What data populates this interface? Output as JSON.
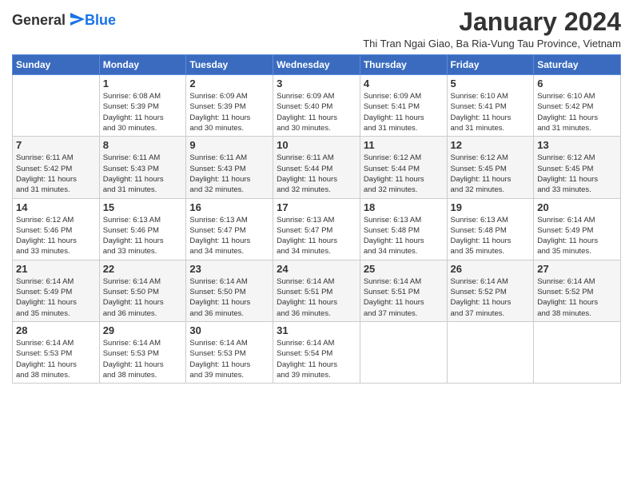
{
  "logo": {
    "general": "General",
    "blue": "Blue"
  },
  "title": "January 2024",
  "subtitle": "Thi Tran Ngai Giao, Ba Ria-Vung Tau Province, Vietnam",
  "days_of_week": [
    "Sunday",
    "Monday",
    "Tuesday",
    "Wednesday",
    "Thursday",
    "Friday",
    "Saturday"
  ],
  "weeks": [
    [
      {
        "day": "",
        "info": ""
      },
      {
        "day": "1",
        "info": "Sunrise: 6:08 AM\nSunset: 5:39 PM\nDaylight: 11 hours\nand 30 minutes."
      },
      {
        "day": "2",
        "info": "Sunrise: 6:09 AM\nSunset: 5:39 PM\nDaylight: 11 hours\nand 30 minutes."
      },
      {
        "day": "3",
        "info": "Sunrise: 6:09 AM\nSunset: 5:40 PM\nDaylight: 11 hours\nand 30 minutes."
      },
      {
        "day": "4",
        "info": "Sunrise: 6:09 AM\nSunset: 5:41 PM\nDaylight: 11 hours\nand 31 minutes."
      },
      {
        "day": "5",
        "info": "Sunrise: 6:10 AM\nSunset: 5:41 PM\nDaylight: 11 hours\nand 31 minutes."
      },
      {
        "day": "6",
        "info": "Sunrise: 6:10 AM\nSunset: 5:42 PM\nDaylight: 11 hours\nand 31 minutes."
      }
    ],
    [
      {
        "day": "7",
        "info": "Sunrise: 6:11 AM\nSunset: 5:42 PM\nDaylight: 11 hours\nand 31 minutes."
      },
      {
        "day": "8",
        "info": "Sunrise: 6:11 AM\nSunset: 5:43 PM\nDaylight: 11 hours\nand 31 minutes."
      },
      {
        "day": "9",
        "info": "Sunrise: 6:11 AM\nSunset: 5:43 PM\nDaylight: 11 hours\nand 32 minutes."
      },
      {
        "day": "10",
        "info": "Sunrise: 6:11 AM\nSunset: 5:44 PM\nDaylight: 11 hours\nand 32 minutes."
      },
      {
        "day": "11",
        "info": "Sunrise: 6:12 AM\nSunset: 5:44 PM\nDaylight: 11 hours\nand 32 minutes."
      },
      {
        "day": "12",
        "info": "Sunrise: 6:12 AM\nSunset: 5:45 PM\nDaylight: 11 hours\nand 32 minutes."
      },
      {
        "day": "13",
        "info": "Sunrise: 6:12 AM\nSunset: 5:45 PM\nDaylight: 11 hours\nand 33 minutes."
      }
    ],
    [
      {
        "day": "14",
        "info": "Sunrise: 6:12 AM\nSunset: 5:46 PM\nDaylight: 11 hours\nand 33 minutes."
      },
      {
        "day": "15",
        "info": "Sunrise: 6:13 AM\nSunset: 5:46 PM\nDaylight: 11 hours\nand 33 minutes."
      },
      {
        "day": "16",
        "info": "Sunrise: 6:13 AM\nSunset: 5:47 PM\nDaylight: 11 hours\nand 34 minutes."
      },
      {
        "day": "17",
        "info": "Sunrise: 6:13 AM\nSunset: 5:47 PM\nDaylight: 11 hours\nand 34 minutes."
      },
      {
        "day": "18",
        "info": "Sunrise: 6:13 AM\nSunset: 5:48 PM\nDaylight: 11 hours\nand 34 minutes."
      },
      {
        "day": "19",
        "info": "Sunrise: 6:13 AM\nSunset: 5:48 PM\nDaylight: 11 hours\nand 35 minutes."
      },
      {
        "day": "20",
        "info": "Sunrise: 6:14 AM\nSunset: 5:49 PM\nDaylight: 11 hours\nand 35 minutes."
      }
    ],
    [
      {
        "day": "21",
        "info": "Sunrise: 6:14 AM\nSunset: 5:49 PM\nDaylight: 11 hours\nand 35 minutes."
      },
      {
        "day": "22",
        "info": "Sunrise: 6:14 AM\nSunset: 5:50 PM\nDaylight: 11 hours\nand 36 minutes."
      },
      {
        "day": "23",
        "info": "Sunrise: 6:14 AM\nSunset: 5:50 PM\nDaylight: 11 hours\nand 36 minutes."
      },
      {
        "day": "24",
        "info": "Sunrise: 6:14 AM\nSunset: 5:51 PM\nDaylight: 11 hours\nand 36 minutes."
      },
      {
        "day": "25",
        "info": "Sunrise: 6:14 AM\nSunset: 5:51 PM\nDaylight: 11 hours\nand 37 minutes."
      },
      {
        "day": "26",
        "info": "Sunrise: 6:14 AM\nSunset: 5:52 PM\nDaylight: 11 hours\nand 37 minutes."
      },
      {
        "day": "27",
        "info": "Sunrise: 6:14 AM\nSunset: 5:52 PM\nDaylight: 11 hours\nand 38 minutes."
      }
    ],
    [
      {
        "day": "28",
        "info": "Sunrise: 6:14 AM\nSunset: 5:53 PM\nDaylight: 11 hours\nand 38 minutes."
      },
      {
        "day": "29",
        "info": "Sunrise: 6:14 AM\nSunset: 5:53 PM\nDaylight: 11 hours\nand 38 minutes."
      },
      {
        "day": "30",
        "info": "Sunrise: 6:14 AM\nSunset: 5:53 PM\nDaylight: 11 hours\nand 39 minutes."
      },
      {
        "day": "31",
        "info": "Sunrise: 6:14 AM\nSunset: 5:54 PM\nDaylight: 11 hours\nand 39 minutes."
      },
      {
        "day": "",
        "info": ""
      },
      {
        "day": "",
        "info": ""
      },
      {
        "day": "",
        "info": ""
      }
    ]
  ]
}
